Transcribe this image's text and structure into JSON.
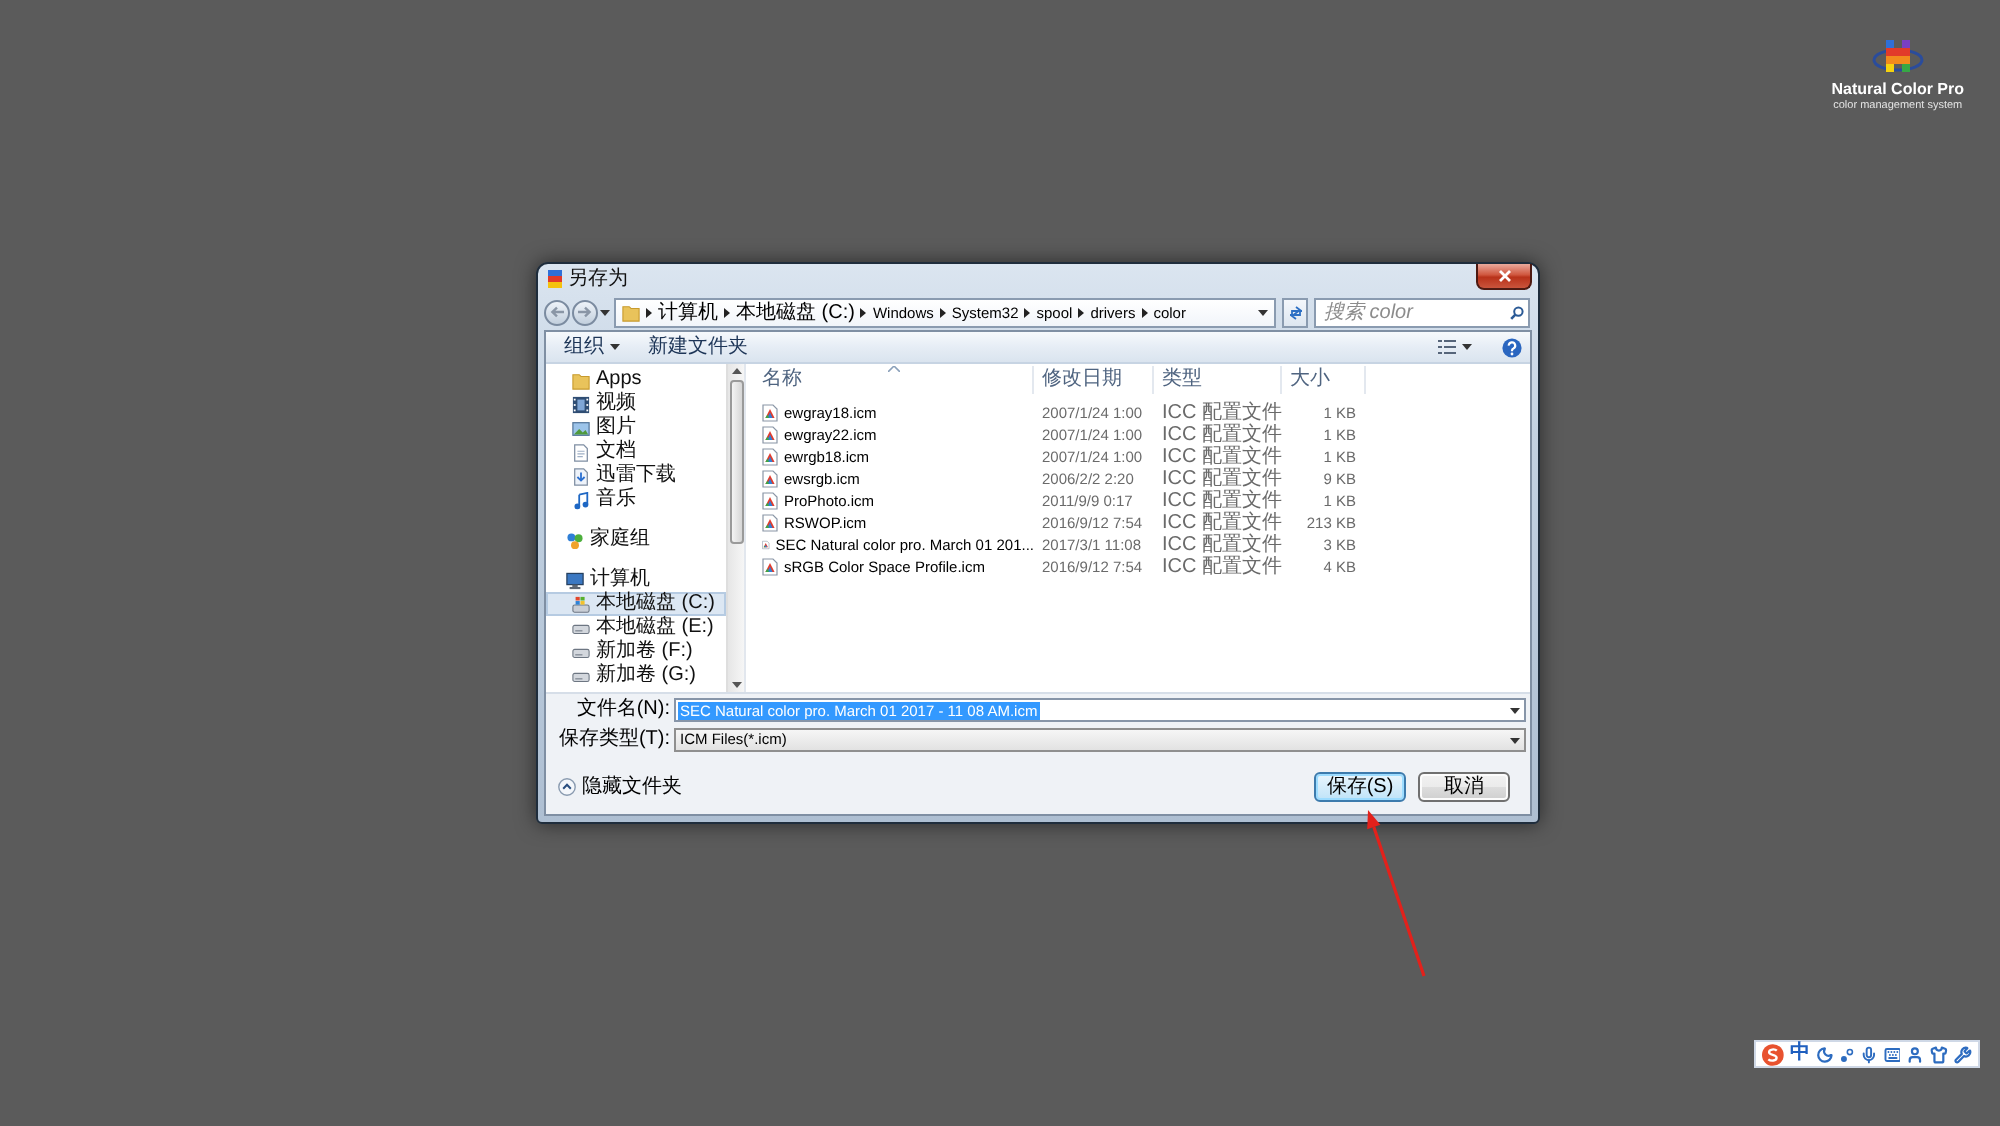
{
  "logo": {
    "title": "Natural Color Pro",
    "subtitle": "color management system"
  },
  "window": {
    "title": "另存为"
  },
  "address_bar": {
    "path": [
      "计算机",
      "本地磁盘 (C:)",
      "Windows",
      "System32",
      "spool",
      "drivers",
      "color"
    ]
  },
  "search": {
    "placeholder": "搜索 color"
  },
  "toolbar": {
    "buttons": [
      {
        "label": "组织",
        "kind": "menu"
      },
      {
        "label": "新建文件夹",
        "kind": "plain"
      }
    ]
  },
  "nav": {
    "sections": [
      {
        "children": [
          {
            "label": "Apps",
            "kind": "folder",
            "selected": false
          },
          {
            "label": "视频",
            "kind": "video",
            "selected": false
          },
          {
            "label": "图片",
            "kind": "pictures",
            "selected": false
          },
          {
            "label": "文档",
            "kind": "documents",
            "selected": false
          },
          {
            "label": "迅雷下载",
            "kind": "downloads",
            "selected": false
          },
          {
            "label": "音乐",
            "kind": "music",
            "selected": false
          }
        ]
      },
      {
        "label": "家庭组",
        "kind": "homegroup",
        "selected": false
      },
      {
        "label": "计算机",
        "kind": "computer",
        "selected": false,
        "children": [
          {
            "label": "本地磁盘 (C:)",
            "kind": "system-drive",
            "selected": true
          },
          {
            "label": "本地磁盘 (E:)",
            "kind": "drive",
            "selected": false
          },
          {
            "label": "新加卷 (F:)",
            "kind": "drive",
            "selected": false
          },
          {
            "label": "新加卷 (G:)",
            "kind": "drive",
            "selected": false
          }
        ]
      }
    ]
  },
  "file_list": {
    "columns": [
      {
        "label": "名称",
        "sorted": true
      },
      {
        "label": "修改日期",
        "sorted": false
      },
      {
        "label": "类型",
        "sorted": false
      },
      {
        "label": "大小",
        "sorted": false
      }
    ],
    "rows": [
      {
        "name": "ewgray18.icm",
        "modified": "2007/1/24 1:00",
        "type": "ICC 配置文件",
        "size": "1 KB",
        "selected": false
      },
      {
        "name": "ewgray22.icm",
        "modified": "2007/1/24 1:00",
        "type": "ICC 配置文件",
        "size": "1 KB",
        "selected": false
      },
      {
        "name": "ewrgb18.icm",
        "modified": "2007/1/24 1:00",
        "type": "ICC 配置文件",
        "size": "1 KB",
        "selected": false
      },
      {
        "name": "ewsrgb.icm",
        "modified": "2006/2/2 2:20",
        "type": "ICC 配置文件",
        "size": "9 KB",
        "selected": false
      },
      {
        "name": "ProPhoto.icm",
        "modified": "2011/9/9 0:17",
        "type": "ICC 配置文件",
        "size": "1 KB",
        "selected": false
      },
      {
        "name": "RSWOP.icm",
        "modified": "2016/9/12 7:54",
        "type": "ICC 配置文件",
        "size": "213 KB",
        "selected": false
      },
      {
        "name": "SEC Natural color pro. March 01 201...",
        "modified": "2017/3/1 11:08",
        "type": "ICC 配置文件",
        "size": "3 KB",
        "selected": false
      },
      {
        "name": "sRGB Color Space Profile.icm",
        "modified": "2016/9/12 7:54",
        "type": "ICC 配置文件",
        "size": "4 KB",
        "selected": false
      }
    ]
  },
  "save_form": {
    "file_name": {
      "label": "文件名(N):",
      "value": "SEC Natural color pro. March 01 2017 - 11 08 AM.icm",
      "highlighted": true
    },
    "file_type": {
      "label": "保存类型(T):",
      "value": "ICM Files(*.icm)"
    }
  },
  "footer": {
    "hide_folders": {
      "label": "隐藏文件夹"
    },
    "buttons": [
      {
        "label": "保存(S)",
        "default": true
      },
      {
        "label": "取消",
        "default": false
      }
    ]
  },
  "ime_toolbar": {
    "mode": "中"
  }
}
